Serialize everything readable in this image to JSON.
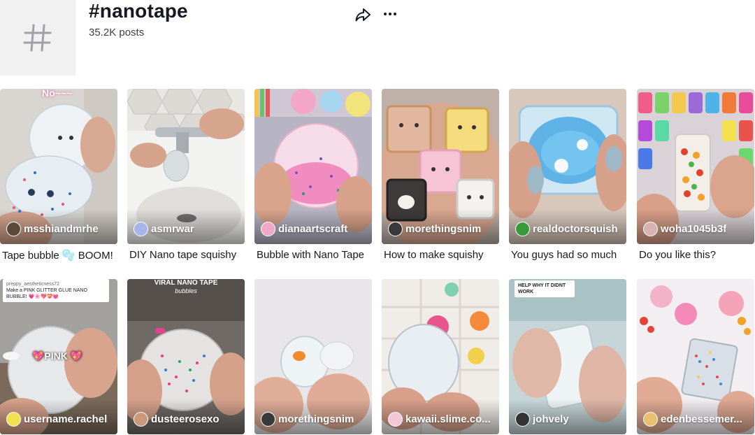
{
  "hashtag": {
    "title": "#nanotape",
    "posts": "35.2K posts",
    "icon": "hash-icon"
  },
  "actions": {
    "share_icon": "share-icon",
    "more_icon": "more-icon"
  },
  "videos": [
    {
      "author": "msshiandmrhe",
      "caption": "Tape bubble 🫧 BOOM!",
      "overlay": "No~~~"
    },
    {
      "author": "asmrwar",
      "caption": "DIY Nano tape squishy",
      "overlay": ""
    },
    {
      "author": "dianaartscraft",
      "caption": "Bubble with Nano Tape",
      "overlay": ""
    },
    {
      "author": "morethingsnim",
      "caption": "How to make squishy",
      "overlay": ""
    },
    {
      "author": "realdoctorsquish",
      "caption": "You guys had so much",
      "overlay": ""
    },
    {
      "author": "woha1045b3f",
      "caption": "Do you like this?",
      "overlay": ""
    },
    {
      "author": "username.rachel",
      "caption": "",
      "overlay": "💖PINK 💖",
      "note_user": "preppy_aestheticness72",
      "note_text": "Make a PINK GLITTER GLUE NANO BUBBLE! 💗🌸💖💝💓"
    },
    {
      "author": "dusteerosexo",
      "caption": "",
      "overlay": "VIRAL NANO TAPE",
      "overlay_sub": "bubbles"
    },
    {
      "author": "morethingsnim",
      "caption": "",
      "overlay": ""
    },
    {
      "author": "kawaii.slime.co...",
      "caption": "",
      "overlay": ""
    },
    {
      "author": "johvely",
      "caption": "",
      "overlay": "",
      "note_text": "HELP WHY IT DIDNT WORK"
    },
    {
      "author": "edenbessemer...",
      "caption": "",
      "overlay": ""
    }
  ]
}
